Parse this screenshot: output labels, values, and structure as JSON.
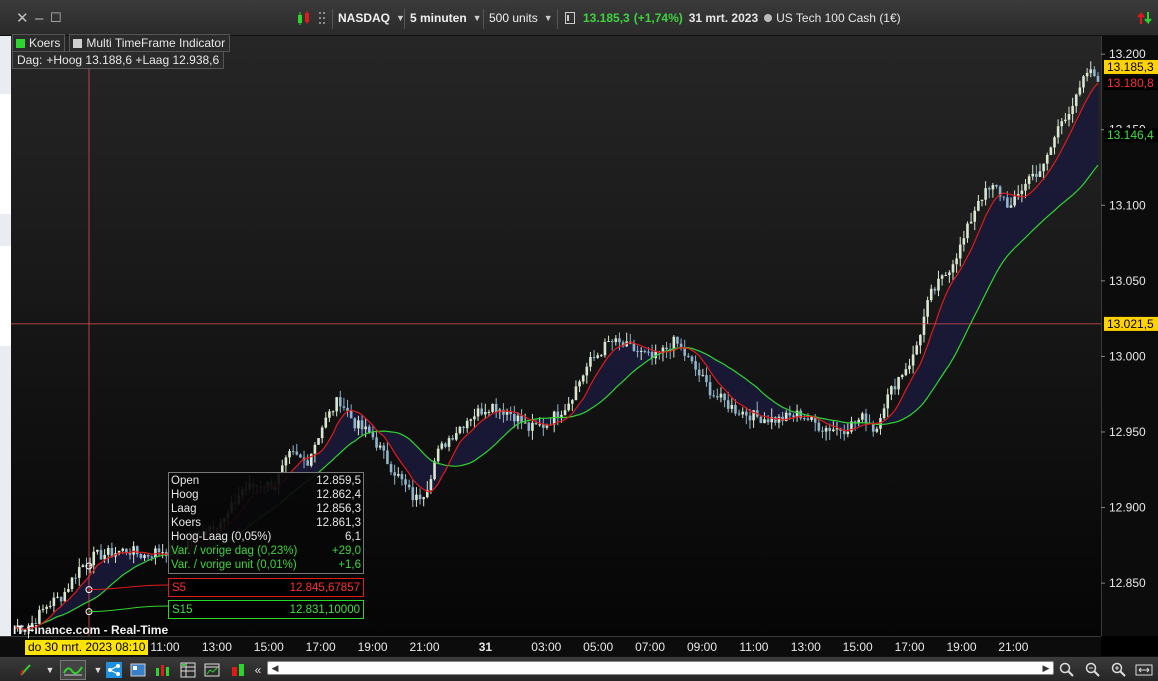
{
  "toolbar": {
    "close_glyph": "✕",
    "minimize_glyph": "–",
    "maximize_glyph": "☐",
    "instrument": "NASDAQ",
    "timeframe": "5 minuten",
    "units": "500 units",
    "last_price": "13.185,3",
    "change": "(+1,74%)",
    "date": "31 mrt. 2023",
    "instrument_name": "US Tech 100 Cash (1€)"
  },
  "legend": {
    "koers": "Koers",
    "mtf": "Multi TimeFrame Indicator",
    "day_label": "Dag:",
    "day_values": "+Hoog 13.188,6 +Laag 12.938,6"
  },
  "tooltip": {
    "rows": [
      {
        "label": "Open",
        "value": "12.859,5"
      },
      {
        "label": "Hoog",
        "value": "12.862,4"
      },
      {
        "label": "Laag",
        "value": "12.856,3"
      },
      {
        "label": "Koers",
        "value": "12.861,3"
      },
      {
        "label": "Hoog-Laag (0,05%)",
        "value": "6,1"
      }
    ],
    "green_rows": [
      {
        "label": "Var. / vorige dag (0,23%)",
        "value": "+29,0"
      },
      {
        "label": "Var. / vorige unit (0,01%)",
        "value": "+1,6"
      }
    ],
    "s5_label": "S5",
    "s5_value": "12.845,67857",
    "s15_label": "S15",
    "s15_value": "12.831,10000"
  },
  "source": "IT-Finance.com - Real-Time",
  "cursor_date": "do 30 mrt. 2023 08:10",
  "colors": {
    "candle_up": "#d8e8d0",
    "candle_down": "#8fb4cc",
    "ma_fast": "#e01a1a",
    "ma_slow": "#2fd52f",
    "fill": "#1a1a38",
    "crosshair": "#e05050",
    "badge_price": "#ffd200"
  },
  "chart_data": {
    "type": "candlestick",
    "title": "NASDAQ",
    "timeframe": "5 minuten",
    "y_range": [
      12815,
      13212
    ],
    "y_ticks": [
      "13.200",
      "13.150",
      "13.100",
      "13.050",
      "13.000",
      "12.950",
      "12.900",
      "12.850"
    ],
    "x_ticks": [
      "11:00",
      "13:00",
      "15:00",
      "17:00",
      "19:00",
      "21:00",
      "31",
      "03:00",
      "05:00",
      "07:00",
      "09:00",
      "11:00",
      "13:00",
      "15:00",
      "17:00",
      "19:00",
      "21:00"
    ],
    "price_badges": {
      "last": "13.185,3",
      "ma_fast": "13.180,8",
      "ma_slow": "13.146,4",
      "crosshair": "13.021,5"
    },
    "crosshair_value": 13021.5,
    "close_path": [
      [
        0,
        12820
      ],
      [
        0.015,
        12822
      ],
      [
        0.03,
        12835
      ],
      [
        0.045,
        12842
      ],
      [
        0.06,
        12860
      ],
      [
        0.075,
        12868
      ],
      [
        0.09,
        12870
      ],
      [
        0.105,
        12872
      ],
      [
        0.12,
        12868
      ],
      [
        0.135,
        12872
      ],
      [
        0.15,
        12870
      ],
      [
        0.165,
        12880
      ],
      [
        0.18,
        12888
      ],
      [
        0.195,
        12892
      ],
      [
        0.21,
        12912
      ],
      [
        0.225,
        12915
      ],
      [
        0.24,
        12915
      ],
      [
        0.255,
        12935
      ],
      [
        0.27,
        12930
      ],
      [
        0.285,
        12955
      ],
      [
        0.3,
        12972
      ],
      [
        0.315,
        12955
      ],
      [
        0.33,
        12948
      ],
      [
        0.345,
        12930
      ],
      [
        0.36,
        12915
      ],
      [
        0.37,
        12905
      ],
      [
        0.38,
        12912
      ],
      [
        0.39,
        12935
      ],
      [
        0.4,
        12945
      ],
      [
        0.42,
        12960
      ],
      [
        0.44,
        12968
      ],
      [
        0.46,
        12962
      ],
      [
        0.475,
        12952
      ],
      [
        0.49,
        12955
      ],
      [
        0.51,
        12968
      ],
      [
        0.53,
        12995
      ],
      [
        0.55,
        13010
      ],
      [
        0.57,
        13005
      ],
      [
        0.59,
        12998
      ],
      [
        0.61,
        13010
      ],
      [
        0.625,
        12995
      ],
      [
        0.645,
        12975
      ],
      [
        0.665,
        12965
      ],
      [
        0.685,
        12960
      ],
      [
        0.705,
        12958
      ],
      [
        0.725,
        12962
      ],
      [
        0.745,
        12953
      ],
      [
        0.765,
        12952
      ],
      [
        0.785,
        12960
      ],
      [
        0.795,
        12950
      ],
      [
        0.8,
        12965
      ],
      [
        0.815,
        12985
      ],
      [
        0.83,
        13000
      ],
      [
        0.845,
        13040
      ],
      [
        0.86,
        13055
      ],
      [
        0.875,
        13075
      ],
      [
        0.89,
        13105
      ],
      [
        0.905,
        13112
      ],
      [
        0.92,
        13098
      ],
      [
        0.935,
        13118
      ],
      [
        0.95,
        13125
      ],
      [
        0.965,
        13155
      ],
      [
        0.98,
        13170
      ],
      [
        0.99,
        13188
      ],
      [
        1.0,
        13185
      ]
    ],
    "series": [
      {
        "name": "S5",
        "color": "red",
        "last": 13180.8
      },
      {
        "name": "S15",
        "color": "green",
        "last": 13146.4
      }
    ]
  }
}
